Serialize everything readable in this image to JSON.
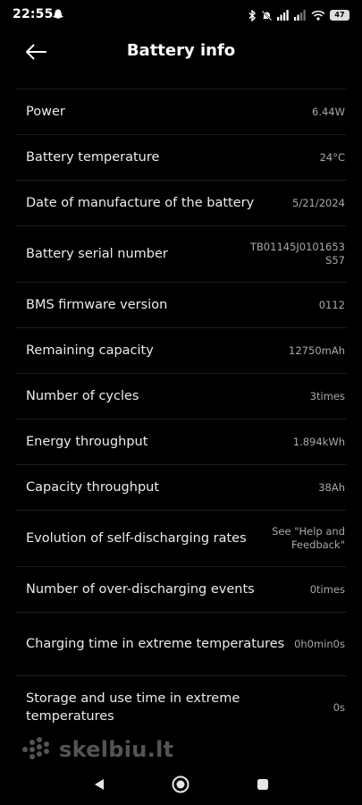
{
  "status_bar": {
    "time": "22:55",
    "battery_level": "47",
    "icons": [
      "snapchat-icon",
      "bluetooth-icon",
      "mute-icon",
      "signal-icon",
      "signal-icon",
      "wifi-icon",
      "battery-icon"
    ]
  },
  "header": {
    "title": "Battery info",
    "back_icon": "arrow-left-icon"
  },
  "rows": [
    {
      "label": "Power",
      "value": "6.44W"
    },
    {
      "label": "Battery temperature",
      "value": "24°C"
    },
    {
      "label": "Date of manufacture of the battery",
      "value": "5/21/2024"
    },
    {
      "label": "Battery serial number",
      "value": "TB01145J0101653S57"
    },
    {
      "label": "BMS firmware version",
      "value": "0112"
    },
    {
      "label": "Remaining capacity",
      "value": "12750mAh"
    },
    {
      "label": "Number of cycles",
      "value": "3times"
    },
    {
      "label": "Energy throughput",
      "value": "1.894kWh"
    },
    {
      "label": "Capacity throughput",
      "value": "38Ah"
    },
    {
      "label": "Evolution of self-discharging rates",
      "value": "See \"Help and Feedback\""
    },
    {
      "label": "Number of over-discharging events",
      "value": "0times"
    },
    {
      "label": "Charging time in extreme temperatures",
      "value": "0h0min0s"
    },
    {
      "label": "Storage and use time in extreme temperatures",
      "value": "0s"
    }
  ],
  "watermark": {
    "text": "skelbiu.lt"
  },
  "nav_bar": {
    "icons": [
      "back-triangle-icon",
      "home-circle-icon",
      "recents-square-icon"
    ]
  },
  "colors": {
    "background": "#000000",
    "label": "#ececec",
    "value": "#a8a8a8",
    "divider": "#1c1c1c"
  }
}
